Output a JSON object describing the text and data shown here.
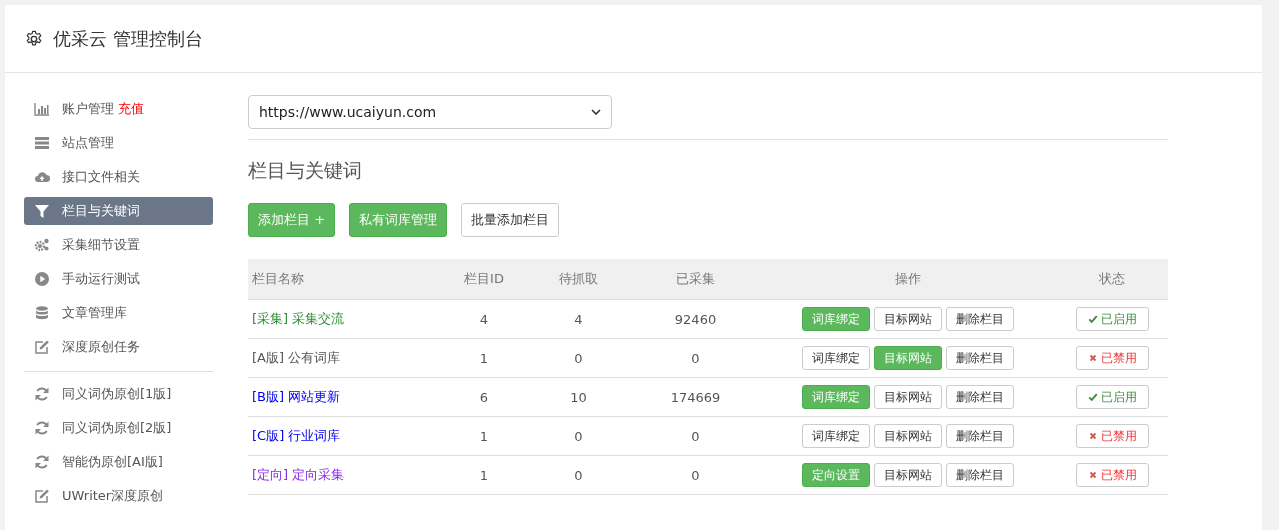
{
  "header": {
    "title": "优采云 管理控制台"
  },
  "sidebar": {
    "items": [
      {
        "label": "账户管理",
        "extra": "充值",
        "kind": "chart",
        "selected": false
      },
      {
        "label": "站点管理",
        "kind": "server",
        "selected": false
      },
      {
        "label": "接口文件相关",
        "kind": "cloud",
        "selected": false
      },
      {
        "label": "栏目与关键词",
        "kind": "filter",
        "selected": true
      },
      {
        "label": "采集细节设置",
        "kind": "gears",
        "selected": false
      },
      {
        "label": "手动运行测试",
        "kind": "play",
        "selected": false
      },
      {
        "label": "文章管理库",
        "kind": "db",
        "selected": false
      },
      {
        "label": "深度原创任务",
        "kind": "edit",
        "selected": false
      }
    ],
    "tools": [
      {
        "label": "同义词伪原创[1版]",
        "kind": "refresh"
      },
      {
        "label": "同义词伪原创[2版]",
        "kind": "refresh"
      },
      {
        "label": "智能伪原创[AI版]",
        "kind": "refresh"
      },
      {
        "label": "UWriter深度原创",
        "kind": "edit"
      }
    ]
  },
  "site_select": {
    "value": "https://www.ucaiyun.com"
  },
  "section_title": "栏目与关键词",
  "toolbar": [
    {
      "label": "添加栏目 +",
      "kind": "primary"
    },
    {
      "label": "私有词库管理",
      "kind": "primary"
    },
    {
      "label": "批量添加栏目",
      "kind": "default"
    }
  ],
  "table": {
    "columns": [
      "栏目名称",
      "栏目ID",
      "待抓取",
      "已采集",
      "操作",
      "状态"
    ],
    "rows": [
      {
        "tag": "[采集]",
        "name": "采集交流",
        "color": "#2e8b2e",
        "id": "4",
        "pending": "4",
        "collected": "92460",
        "actions": [
          {
            "label": "词库绑定",
            "selected": true
          },
          {
            "label": "目标网站",
            "selected": false
          },
          {
            "label": "删除栏目",
            "selected": false
          }
        ],
        "status": "已启用",
        "enabled": true
      },
      {
        "tag": "[A版]",
        "name": "公有词库",
        "color": "#555555",
        "id": "1",
        "pending": "0",
        "collected": "0",
        "actions": [
          {
            "label": "词库绑定",
            "selected": false
          },
          {
            "label": "目标网站",
            "selected": true
          },
          {
            "label": "删除栏目",
            "selected": false
          }
        ],
        "status": "已禁用",
        "enabled": false
      },
      {
        "tag": "[B版]",
        "name": "网站更新",
        "color": "#0000ee",
        "id": "6",
        "pending": "10",
        "collected": "174669",
        "actions": [
          {
            "label": "词库绑定",
            "selected": true
          },
          {
            "label": "目标网站",
            "selected": false
          },
          {
            "label": "删除栏目",
            "selected": false
          }
        ],
        "status": "已启用",
        "enabled": true
      },
      {
        "tag": "[C版]",
        "name": "行业词库",
        "color": "#0000ee",
        "id": "1",
        "pending": "0",
        "collected": "0",
        "actions": [
          {
            "label": "词库绑定",
            "selected": false
          },
          {
            "label": "目标网站",
            "selected": false
          },
          {
            "label": "删除栏目",
            "selected": false
          }
        ],
        "status": "已禁用",
        "enabled": false
      },
      {
        "tag": "[定向]",
        "name": "定向采集",
        "color": "#8a2be2",
        "id": "1",
        "pending": "0",
        "collected": "0",
        "actions": [
          {
            "label": "定向设置",
            "selected": true
          },
          {
            "label": "目标网站",
            "selected": false
          },
          {
            "label": "删除栏目",
            "selected": false
          }
        ],
        "status": "已禁用",
        "enabled": false
      }
    ]
  }
}
